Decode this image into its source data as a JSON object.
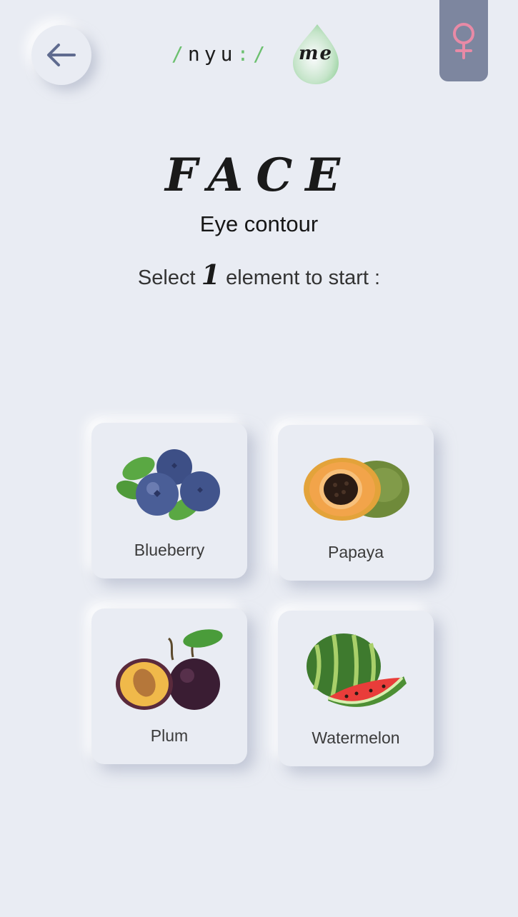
{
  "header": {
    "back_icon": "arrow-left-icon",
    "logo": {
      "slash_open": "/",
      "word": "nyu",
      "colon": ":",
      "slash_close": "/",
      "suffix": "me"
    },
    "gender_icon": "female-symbol-icon"
  },
  "main": {
    "title": "FACE",
    "subtitle": "Eye contour",
    "instruction": {
      "before": "Select",
      "number": "1",
      "after": "element to start :"
    }
  },
  "options": [
    {
      "label": "Blueberry",
      "icon": "blueberry-icon"
    },
    {
      "label": "Papaya",
      "icon": "papaya-icon"
    },
    {
      "label": "Plum",
      "icon": "plum-icon"
    },
    {
      "label": "Watermelon",
      "icon": "watermelon-icon"
    }
  ],
  "colors": {
    "background": "#e9ecf3",
    "accent_green": "#6cc06f",
    "tab_gray": "#7d869f",
    "female_pink": "#e88aa6",
    "arrow_blue": "#5f6b8f"
  }
}
